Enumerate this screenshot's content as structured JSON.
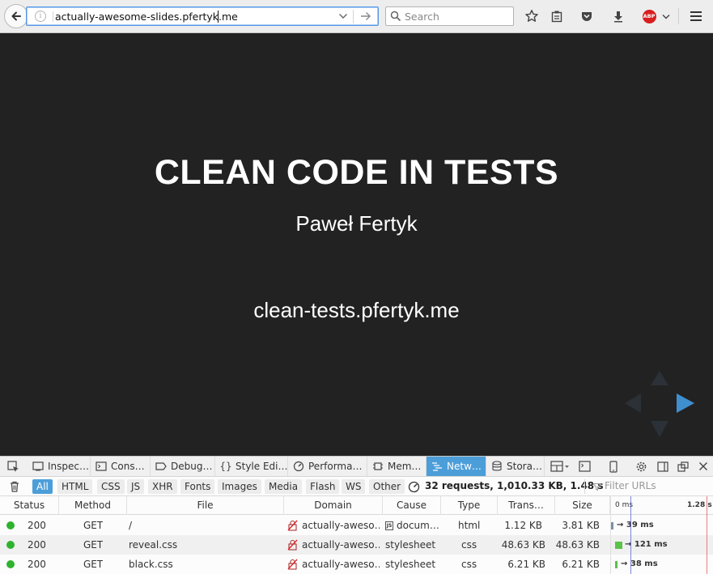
{
  "browser": {
    "url": "actually-awesome-slides.pfertyk.me",
    "search_placeholder": "Search"
  },
  "slide": {
    "title": "CLEAN CODE IN TESTS",
    "author": "Paweł Fertyk",
    "link": "clean-tests.pfertyk.me"
  },
  "devtools": {
    "tabs": [
      {
        "label": "Inspec…",
        "icon": "inspector-icon"
      },
      {
        "label": "Cons…",
        "icon": "console-icon"
      },
      {
        "label": "Debug…",
        "icon": "debugger-icon"
      },
      {
        "label": "Style Edi…",
        "icon": "style-editor-icon"
      },
      {
        "label": "Performa…",
        "icon": "performance-icon"
      },
      {
        "label": "Mem…",
        "icon": "memory-icon"
      },
      {
        "label": "Netw…",
        "icon": "network-icon"
      },
      {
        "label": "Stora…",
        "icon": "storage-icon"
      }
    ],
    "active_tab": "Netw…",
    "filters": [
      "All",
      "HTML",
      "CSS",
      "JS",
      "XHR",
      "Fonts",
      "Images",
      "Media",
      "Flash",
      "WS",
      "Other"
    ],
    "active_filter": "All",
    "summary": "32 requests, 1,010.33 KB, 1.48 s",
    "filter_placeholder": "Filter URLs",
    "columns": [
      "Status",
      "Method",
      "File",
      "Domain",
      "Cause",
      "Type",
      "Trans…",
      "Size"
    ],
    "waterfall_ticks": [
      "0 ms",
      "1.28 s"
    ],
    "rows": [
      {
        "status": "200",
        "method": "GET",
        "file": "/",
        "domain": "actually-aweso…",
        "cause": "docum…",
        "cause_icon": "js-badge-icon",
        "type": "html",
        "transferred": "1.12 KB",
        "size": "3.81 KB",
        "time": "39 ms"
      },
      {
        "status": "200",
        "method": "GET",
        "file": "reveal.css",
        "domain": "actually-aweso…",
        "cause": "stylesheet",
        "cause_icon": "",
        "type": "css",
        "transferred": "48.63 KB",
        "size": "48.63 KB",
        "time": "121 ms"
      },
      {
        "status": "200",
        "method": "GET",
        "file": "black.css",
        "domain": "actually-aweso…",
        "cause": "stylesheet",
        "cause_icon": "",
        "type": "css",
        "transferred": "6.21 KB",
        "size": "6.21 KB",
        "time": "38 ms"
      }
    ]
  }
}
